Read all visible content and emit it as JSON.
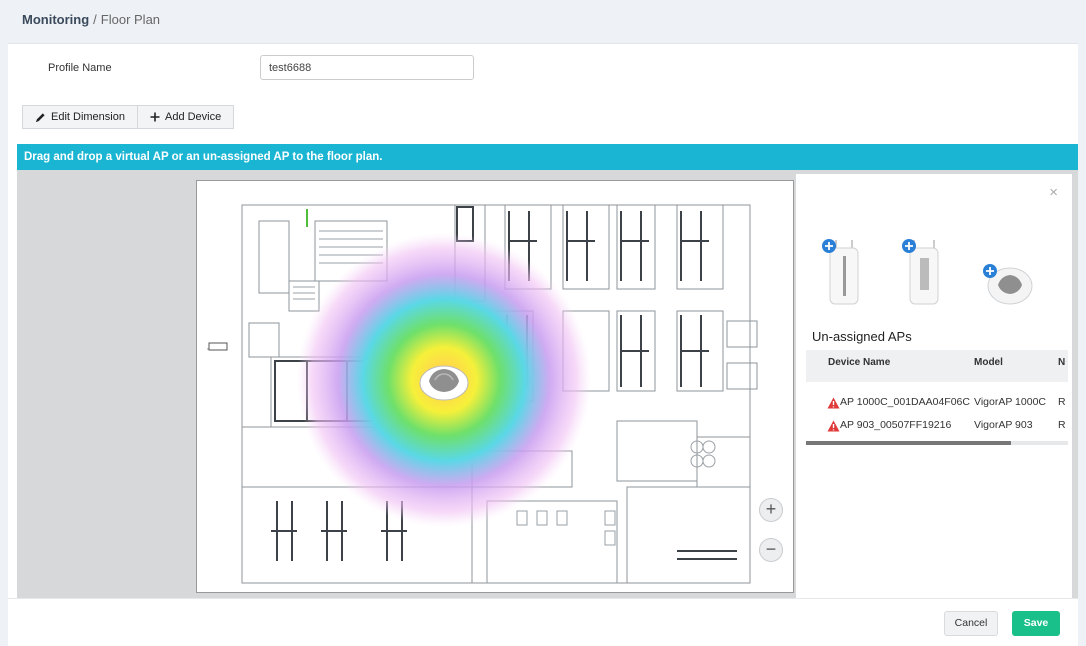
{
  "breadcrumb": {
    "section": "Monitoring",
    "separator": "/",
    "page": "Floor Plan"
  },
  "profile": {
    "label": "Profile Name",
    "value": "test6688"
  },
  "toolbar": {
    "edit_dimension": "Edit Dimension",
    "add_device": "Add Device"
  },
  "banner": "Drag and drop a virtual AP or an un-assigned AP to the floor plan.",
  "zoom": {
    "in": "+",
    "out": "−"
  },
  "panel": {
    "close": "×",
    "title": "Un-assigned APs",
    "columns": [
      "Device Name",
      "Model",
      "N"
    ],
    "rows": [
      {
        "name": "AP 1000C_001DAA04F06C",
        "model": "VigorAP 1000C",
        "extra": "R"
      },
      {
        "name": "AP 903_00507FF19216",
        "model": "VigorAP 903",
        "extra": "R"
      }
    ]
  },
  "footer": {
    "cancel": "Cancel",
    "save": "Save"
  },
  "colors": {
    "banner": "#1ab5d2",
    "save": "#19c08a",
    "warning": "#e03a3a"
  }
}
